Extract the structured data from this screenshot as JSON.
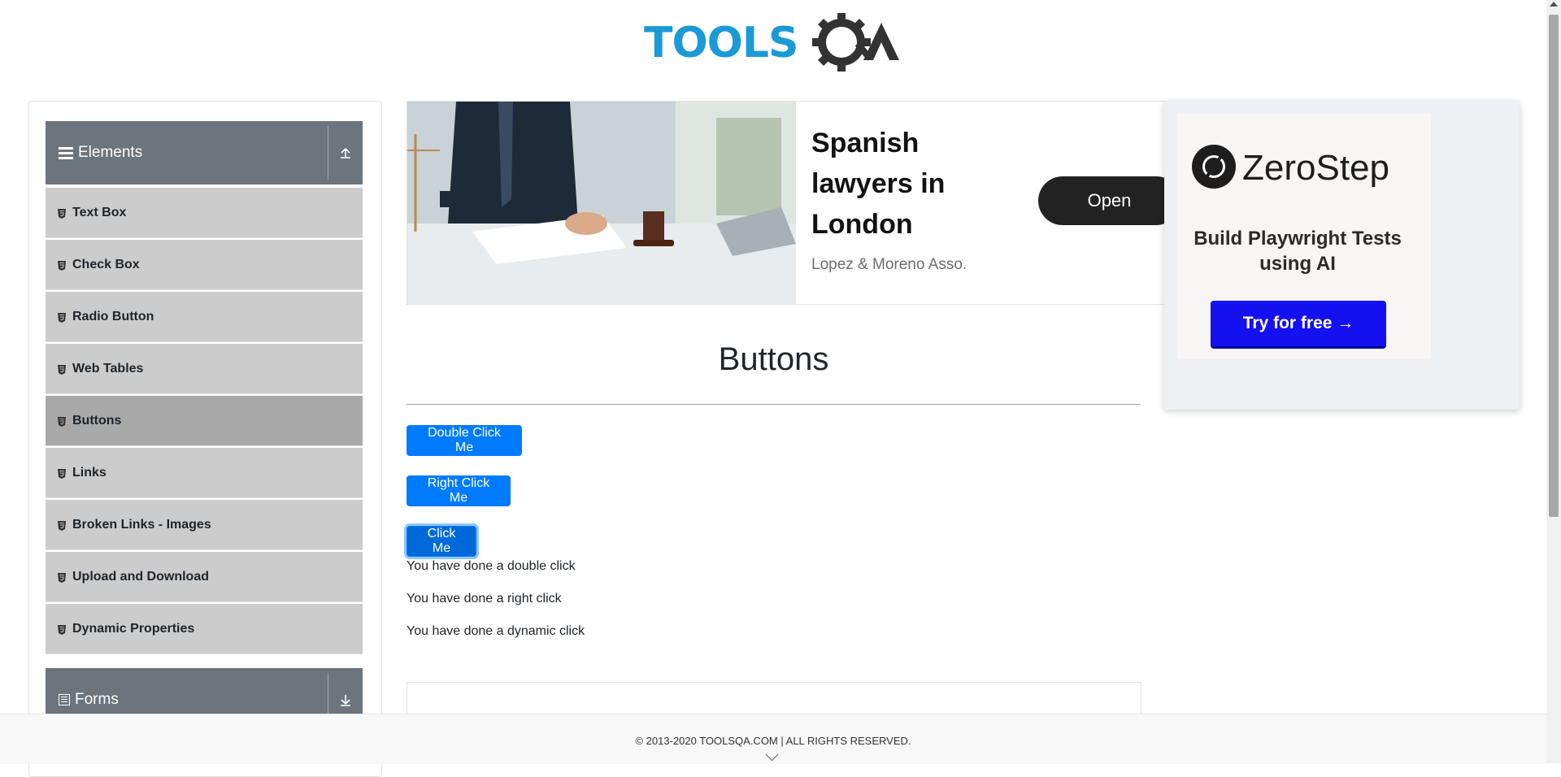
{
  "brand": {
    "logo_text": "TOOLSQA"
  },
  "sidebar": {
    "group_elements": {
      "title": "Elements",
      "toggle_icon": "upload-arrow-icon"
    },
    "items": [
      {
        "label": "Text Box"
      },
      {
        "label": "Check Box"
      },
      {
        "label": "Radio Button"
      },
      {
        "label": "Web Tables"
      },
      {
        "label": "Buttons",
        "active": true
      },
      {
        "label": "Links"
      },
      {
        "label": "Broken Links - Images"
      },
      {
        "label": "Upload and Download"
      },
      {
        "label": "Dynamic Properties"
      }
    ],
    "group_forms": {
      "title": "Forms",
      "toggle_icon": "download-arrow-icon"
    }
  },
  "ad_banner": {
    "headline": "Spanish lawyers in London",
    "advertiser": "Lopez & Moreno Asso.",
    "cta": "Open"
  },
  "side_ad": {
    "brand": "ZeroStep",
    "tagline": "Build Playwright Tests using AI",
    "cta": "Try for free →"
  },
  "main": {
    "title": "Buttons",
    "buttons": {
      "double_click": "Double Click Me",
      "right_click": "Right Click Me",
      "click": "Click Me"
    },
    "messages": {
      "double": "You have done a double click",
      "right": "You have done a right click",
      "dynamic": "You have done a dynamic click"
    }
  },
  "footer": {
    "text": "© 2013-2020 TOOLSQA.COM | ALL RIGHTS RESERVED."
  },
  "colors": {
    "primary": "#007bff",
    "sidebar_header": "#6c757d",
    "sidebar_item": "#cccccc",
    "sidebar_active": "#a9a9a9",
    "brand_blue": "#1a9ad6"
  }
}
